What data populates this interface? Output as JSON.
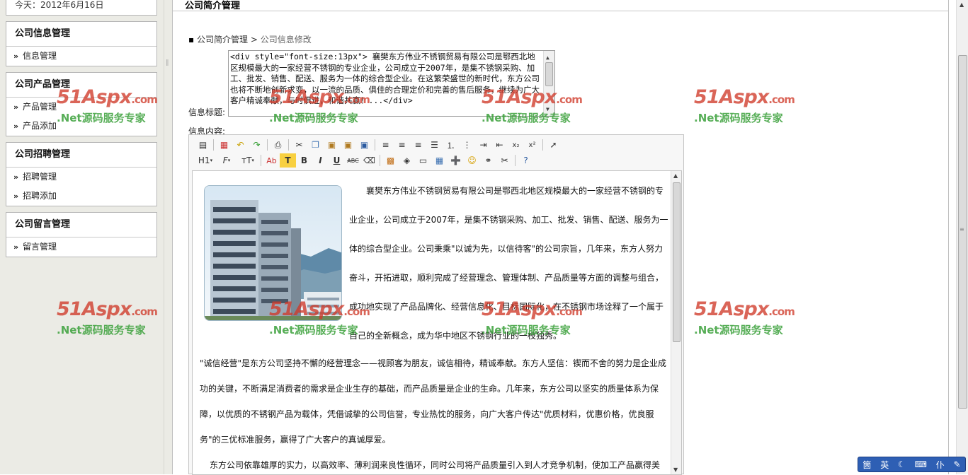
{
  "sidebar": {
    "date": "今天：2012年6月16日",
    "groups": [
      {
        "title": "公司信息管理",
        "items": [
          "信息管理"
        ]
      },
      {
        "title": "公司产品管理",
        "items": [
          "产品管理",
          "产品添加"
        ]
      },
      {
        "title": "公司招聘管理",
        "items": [
          "招聘管理",
          "招聘添加"
        ]
      },
      {
        "title": "公司留言管理",
        "items": [
          "留言管理"
        ]
      }
    ],
    "item_marker": "»"
  },
  "main": {
    "page_title": "公司简介管理",
    "breadcrumb": {
      "bullet": "▪",
      "root": "公司简介管理",
      "sep": ">",
      "current": "公司信息修改"
    },
    "title_label": "信息标题:",
    "content_label": "信息内容:",
    "title_value": "<div style=\"font-size:13px\">     襄樊东方伟业不锈钢贸易有限公司是鄂西北地区规模最大的一家经营不锈钢的专业企业，公司成立于2007年，是集不锈钢采购、加工、批发、销售、配送、服务为一体的综合型企业。在这繁荣盛世的新时代，东方公司也将不断地创新求变，以一流的品质、俱佳的合理定价和完善的售后服务，继续为广大客户精诚奉献，与时俱进，和谐共赢！...</div>"
  },
  "toolbar": {
    "row1": [
      "source",
      "|",
      "template",
      "undo",
      "redo",
      "|",
      "print",
      "|",
      "cut",
      "copy",
      "paste",
      "paste-text",
      "paste-word",
      "|",
      "align-left",
      "align-center",
      "align-right",
      "align-justify",
      "ordered-list",
      "unordered-list",
      "indent",
      "outdent",
      "subscript",
      "superscript",
      "|",
      "select"
    ],
    "row2_labels": {
      "heading": "H1",
      "font": "F",
      "size": "тT"
    }
  },
  "editor_content": {
    "para1": "襄樊东方伟业不锈钢贸易有限公司是鄂西北地区规模最大的一家经营不锈钢的专业企业，公司成立于2007年，是集不锈钢采购、加工、批发、销售、配送、服务为一体的综合型企业。公司秉乘\"以诚为先，以信待客\"的公司宗旨，几年来，东方人努力奋斗，开拓进取，顺利完成了经营理念、管理体制、产品质量等方面的调整与组合，成功地实现了产品品牌化、经营信息化、目标国际化，在不锈钢市场诠释了一个属于自己的全新概念，成为华中地区不锈钢行业的一枝独秀。",
    "para2": "\"诚信经营\"是东方公司坚持不懈的经营理念——视顾客为朋友，诚信相待，精诚奉献。东方人坚信：锲而不舍的努力是企业成功的关键，不断满足消费者的需求是企业生存的基础，而产品质量是企业的生命。几年来，东方公司以坚实的质量体系为保障，以优质的不锈钢产品为载体，凭借诚挚的公司信誉，专业热忱的服务，向广大客户传达\"优质材料，优惠价格，优良服务\"的三优标准服务，赢得了广大客户的真诚厚爱。",
    "para3": "东方公司依靠雄厚的实力，以高效率、薄利润来良性循环，同时公司将产品质量引入到人才竞争机制，使加工产品赢得美"
  },
  "watermark": {
    "logo": "51Aspx",
    "suffix": ".com",
    "tagline": ".Net源码服务专家"
  },
  "ime": {
    "a": "箇",
    "b": "英",
    "c": "☾",
    "d": "⌨",
    "e": "仆",
    "f": "✎"
  },
  "colors": {
    "sidebar_bg": "#ebebe5",
    "watermark_red": "#d03a2a",
    "watermark_green": "#3aa03a",
    "ime_bg": "#2e5fb4"
  }
}
